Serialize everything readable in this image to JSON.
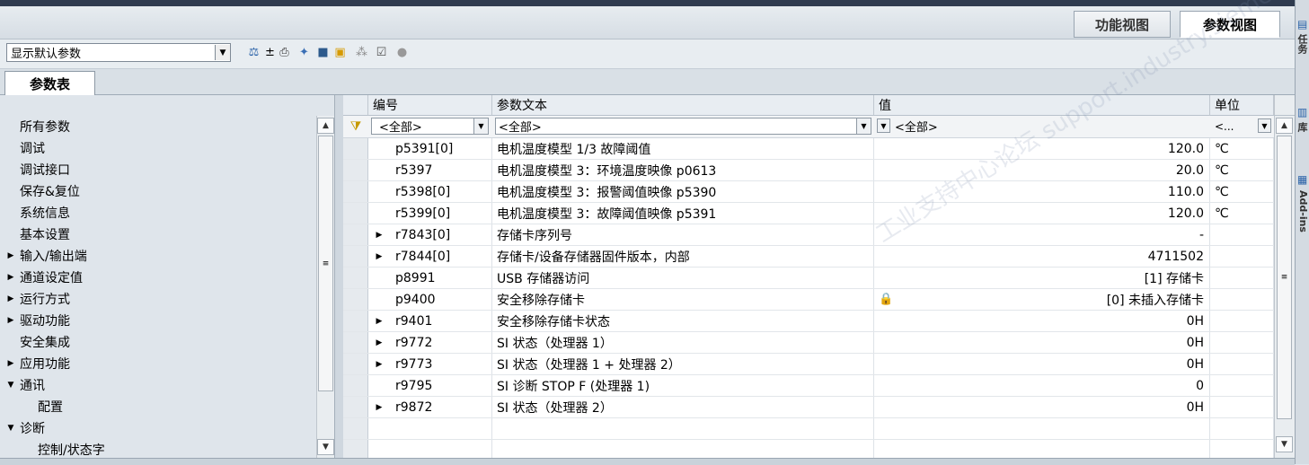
{
  "view_tabs": [
    "功能视图",
    "参数视图"
  ],
  "toolbar": {
    "filter_select_value": "显示默认参数"
  },
  "tabs": {
    "param_table": "参数表"
  },
  "tree": [
    {
      "label": "所有参数",
      "expander": "",
      "indent": 0,
      "selected": true
    },
    {
      "label": "调试",
      "expander": "",
      "indent": 0
    },
    {
      "label": "调试接口",
      "expander": "",
      "indent": 0
    },
    {
      "label": "保存&复位",
      "expander": "",
      "indent": 0
    },
    {
      "label": "系统信息",
      "expander": "",
      "indent": 0
    },
    {
      "label": "基本设置",
      "expander": "",
      "indent": 0
    },
    {
      "label": "输入/输出端",
      "expander": "▶",
      "indent": 0
    },
    {
      "label": "通道设定值",
      "expander": "▶",
      "indent": 0
    },
    {
      "label": "运行方式",
      "expander": "▶",
      "indent": 0
    },
    {
      "label": "驱动功能",
      "expander": "▶",
      "indent": 0
    },
    {
      "label": "安全集成",
      "expander": "",
      "indent": 0
    },
    {
      "label": "应用功能",
      "expander": "▶",
      "indent": 0
    },
    {
      "label": "通讯",
      "expander": "▼",
      "indent": 0
    },
    {
      "label": "配置",
      "expander": "",
      "indent": 1
    },
    {
      "label": "诊断",
      "expander": "▼",
      "indent": 0
    },
    {
      "label": "控制/状态字",
      "expander": "",
      "indent": 1
    }
  ],
  "table": {
    "headers": {
      "number": "编号",
      "text": "参数文本",
      "value": "值",
      "unit": "单位"
    },
    "filters": {
      "number": "<全部>",
      "text": "<全部>",
      "value": "<全部>",
      "unit": "<..."
    },
    "rows": [
      {
        "expander": "",
        "number": "p5391[0]",
        "text": "电机温度模型 1/3 故障阈值",
        "value": "120.0",
        "unit": "℃",
        "lock": false
      },
      {
        "expander": "",
        "number": "r5397",
        "text": "电机温度模型 3：环境温度映像 p0613",
        "value": "20.0",
        "unit": "℃",
        "lock": false
      },
      {
        "expander": "",
        "number": "r5398[0]",
        "text": "电机温度模型 3：报警阈值映像 p5390",
        "value": "110.0",
        "unit": "℃",
        "lock": false
      },
      {
        "expander": "",
        "number": "r5399[0]",
        "text": "电机温度模型 3：故障阈值映像 p5391",
        "value": "120.0",
        "unit": "℃",
        "lock": false
      },
      {
        "expander": "▶",
        "number": "r7843[0]",
        "text": "存储卡序列号",
        "value": "-",
        "unit": "",
        "lock": false
      },
      {
        "expander": "▶",
        "number": "r7844[0]",
        "text": "存储卡/设备存储器固件版本，内部",
        "value": "4711502",
        "unit": "",
        "lock": false
      },
      {
        "expander": "",
        "number": "p8991",
        "text": "USB 存储器访问",
        "value": "[1] 存储卡",
        "unit": "",
        "lock": false
      },
      {
        "expander": "",
        "number": "p9400",
        "text": "安全移除存储卡",
        "value": "[0] 未插入存储卡",
        "unit": "",
        "lock": true
      },
      {
        "expander": "▶",
        "number": "r9401",
        "text": "安全移除存储卡状态",
        "value": "0H",
        "unit": "",
        "lock": false
      },
      {
        "expander": "▶",
        "number": "r9772",
        "text": "SI 状态（处理器 1）",
        "value": "0H",
        "unit": "",
        "lock": false
      },
      {
        "expander": "▶",
        "number": "r9773",
        "text": "SI 状态（处理器 1 + 处理器 2）",
        "value": "0H",
        "unit": "",
        "lock": false
      },
      {
        "expander": "",
        "number": "r9795",
        "text": "SI 诊断 STOP F (处理器 1)",
        "value": "0",
        "unit": "",
        "lock": false
      },
      {
        "expander": "▶",
        "number": "r9872",
        "text": "SI 状态（处理器 2）",
        "value": "0H",
        "unit": "",
        "lock": false
      }
    ]
  },
  "side_tabs": [
    "任务",
    "库",
    "Add-ins"
  ],
  "watermark": "工业支持中心论坛 support.industry.siemens.com/cs",
  "colors": {
    "accent": "#2f3b4f",
    "lock": "#d7a300"
  }
}
